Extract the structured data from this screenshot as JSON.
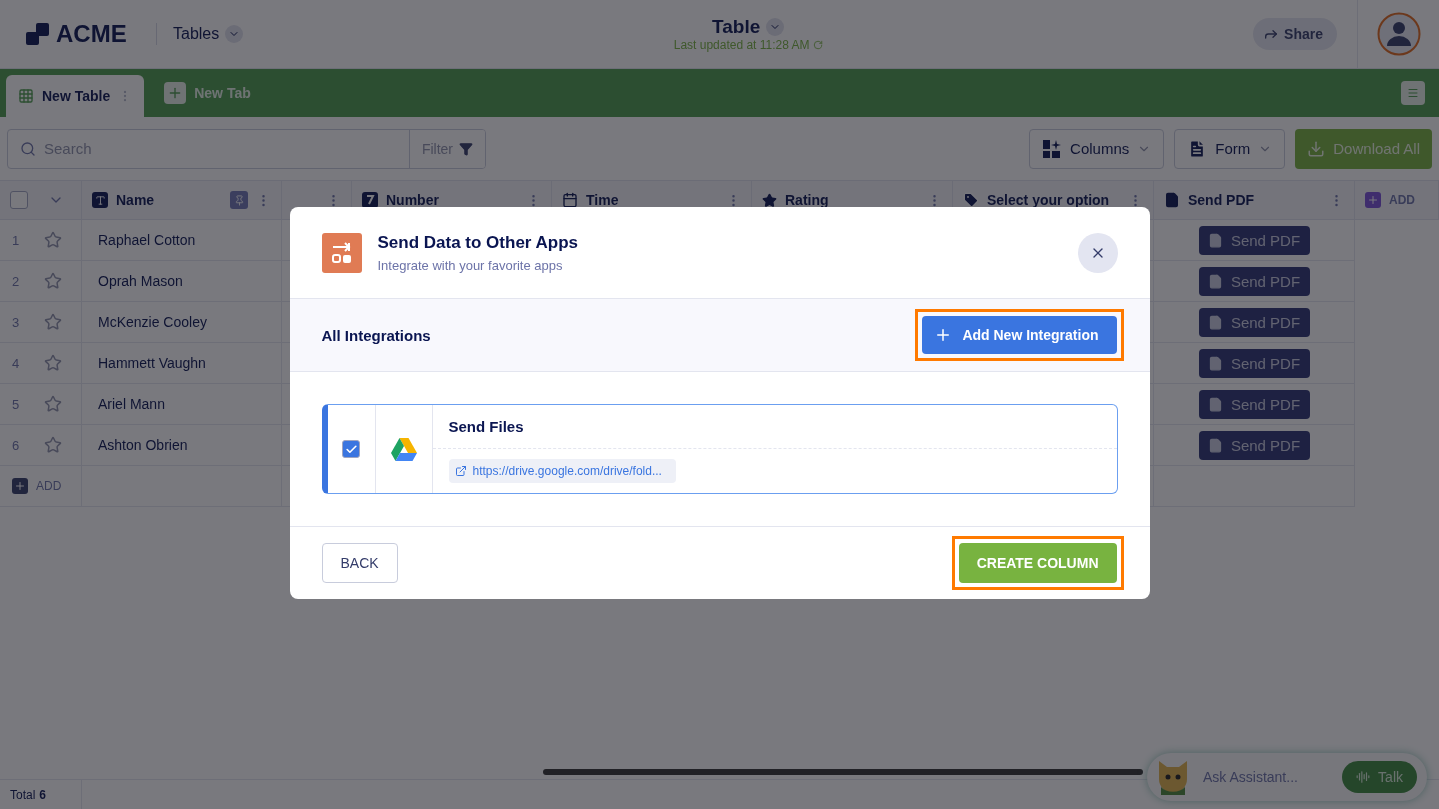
{
  "header": {
    "logo": "ACME",
    "nav": "Tables",
    "title": "Table",
    "updated": "Last updated at 11:28 AM",
    "share": "Share"
  },
  "tabs": [
    {
      "kind": "table",
      "label": "New Table",
      "selected": true
    },
    {
      "kind": "add",
      "label": "New Tab",
      "selected": false
    }
  ],
  "toolbar": {
    "search": {
      "placeholder": "Search"
    },
    "filter": "Filter",
    "columns": "Columns",
    "form": "Form",
    "download": "Download All"
  },
  "table": {
    "select_all_checked": false,
    "columns": [
      {
        "kind": "text",
        "label": "Name",
        "pinned": true
      },
      {
        "kind": "blank"
      },
      {
        "kind": "number",
        "label": "Number"
      },
      {
        "kind": "time",
        "label": "Time"
      },
      {
        "kind": "rating",
        "label": "Rating"
      },
      {
        "kind": "option",
        "label": "Select your option"
      },
      {
        "kind": "pdf",
        "label": "Send PDF"
      }
    ],
    "add_column": "ADD",
    "rows": [
      {
        "number": "1",
        "starred": false,
        "name": "Raphael Cotton",
        "action": "Send PDF"
      },
      {
        "number": "2",
        "starred": false,
        "name": "Oprah Mason",
        "action": "Send PDF"
      },
      {
        "number": "3",
        "starred": false,
        "name": "McKenzie Cooley",
        "action": "Send PDF"
      },
      {
        "number": "4",
        "starred": false,
        "name": "Hammett Vaughn",
        "action": "Send PDF"
      },
      {
        "number": "5",
        "starred": false,
        "name": "Ariel Mann",
        "action": "Send PDF"
      },
      {
        "number": "6",
        "starred": false,
        "name": "Ashton Obrien",
        "action": "Send PDF"
      }
    ],
    "add_row": "ADD"
  },
  "footer": {
    "total_label": "Total",
    "total": "6"
  },
  "modal": {
    "title": "Send Data to Other Apps",
    "subtitle": "Integrate with your favorite apps",
    "section": "All Integrations",
    "add_button": {
      "label": "Add New Integration",
      "highlighted": true
    },
    "integrations": [
      {
        "name": "Send Files",
        "link": "https://drive.google.com/drive/fold...",
        "checked": true
      }
    ],
    "back": "BACK",
    "create": {
      "label": "CREATE COLUMN",
      "highlighted": true
    }
  },
  "assistant": {
    "placeholder": "Ask Assistant...",
    "talk": "Talk"
  }
}
